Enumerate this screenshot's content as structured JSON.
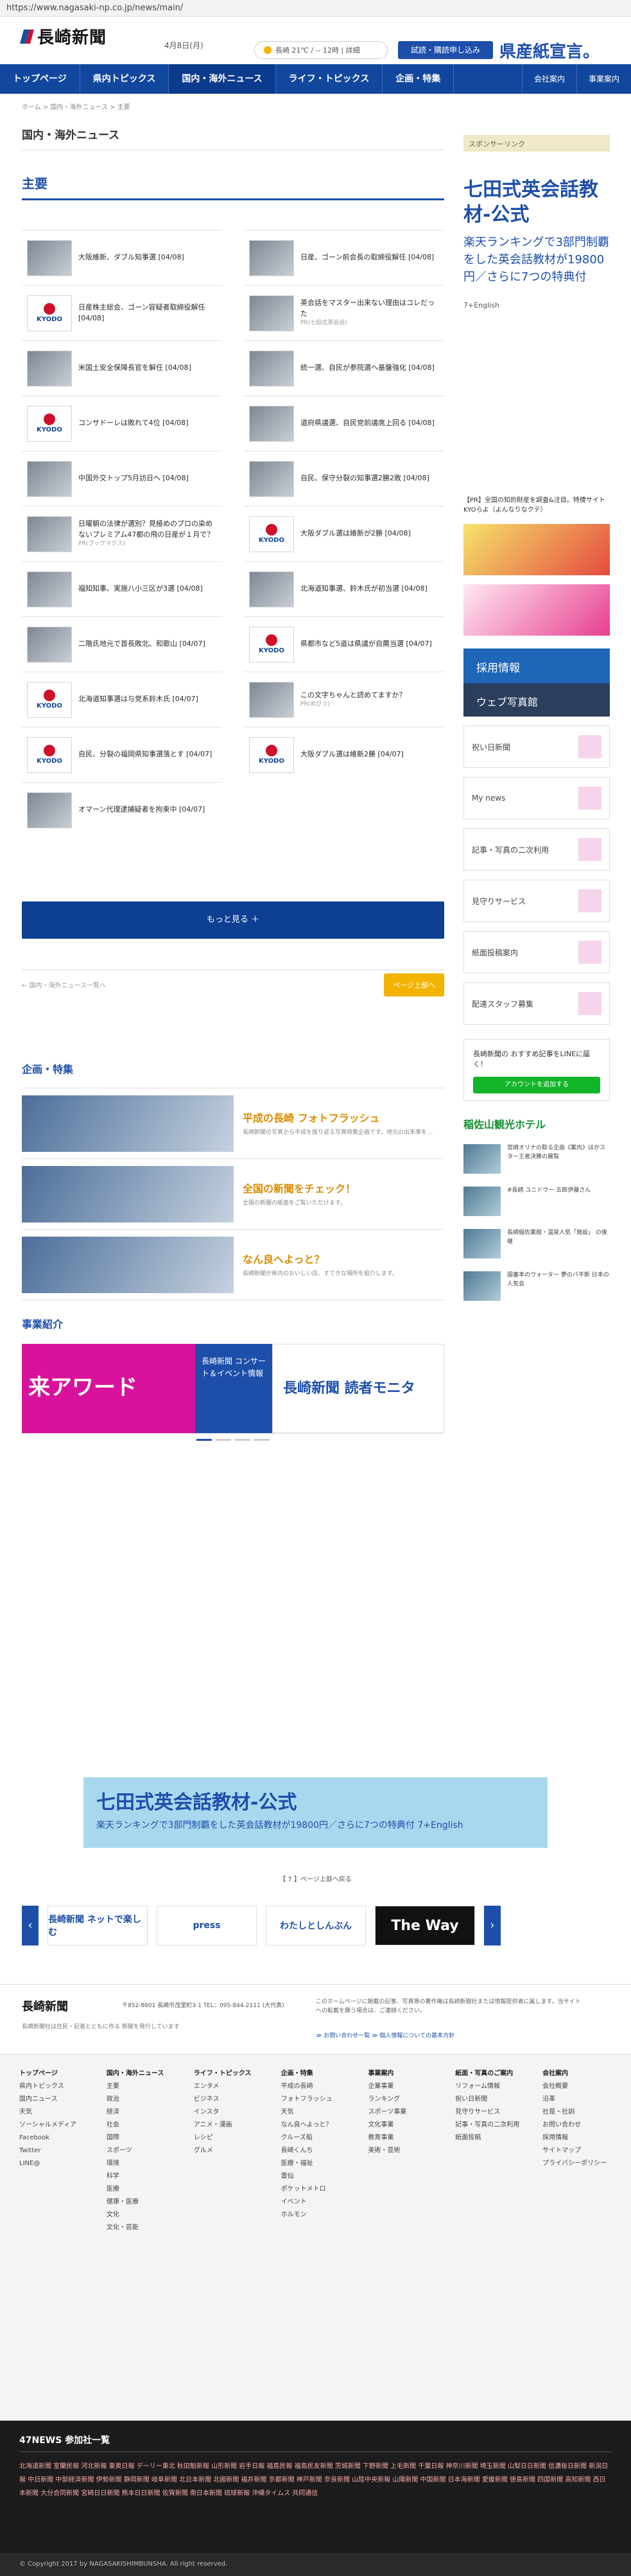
{
  "browser": {
    "url": "https://www.nagasaki-np.co.jp/news/main/"
  },
  "header": {
    "logo": "長崎新聞",
    "date": "4月8日(月)",
    "weather_text": "長崎  21℃ /  -- 12時   |  詳細",
    "trial_btn": "試読・購読申し込み",
    "slogan": "県産紙宣言。"
  },
  "nav": {
    "items": [
      "トップページ",
      "県内トピックス",
      "国内・海外ニュース",
      "ライフ・トピックス",
      "企画・特集"
    ],
    "active_index": 2,
    "right": [
      "会社案内",
      "事業案内"
    ]
  },
  "breadcrumb": "ホーム  >  国内・海外ニュース  >  主要",
  "section_title": "国内・海外ニュース",
  "sub_title": "主要",
  "news": [
    {
      "text": "大阪維新、ダブル知事選 [04/08]",
      "thumb": "photo"
    },
    {
      "text": "日産、ゴーン前会長の取締役解任 [04/08]",
      "thumb": "photo"
    },
    {
      "text": "日産株主総会、ゴーン容疑者取締役解任 [04/08]",
      "thumb": "kyodo"
    },
    {
      "text": "英会話をマスター出来ない理由はコレだった",
      "thumb": "photo",
      "sponsor": "PR(七田式英会話)"
    },
    {
      "text": "米国土安全保障長官を解任 [04/08]",
      "thumb": "photo"
    },
    {
      "text": "統一選、自民が参院選へ基盤強化 [04/08]",
      "thumb": "photo"
    },
    {
      "text": "コンサドーレは敗れて4位 [04/08]",
      "thumb": "kyodo"
    },
    {
      "text": "道府県議選、自民党前議席上回る [04/08]",
      "thumb": "photo"
    },
    {
      "text": "中国外交トップ5月訪日へ [04/08]",
      "thumb": "photo"
    },
    {
      "text": "自民、保守分裂の知事選2勝2敗 [04/08]",
      "thumb": "photo"
    },
    {
      "text": "日曜朝の法律が選別？見極めのプロの染めないプレミアム47都の飛の日産が１月で？",
      "thumb": "photo",
      "sponsor": "PR(ブックマグス)"
    },
    {
      "text": "大阪ダブル選は維新が2勝 [04/08]",
      "thumb": "kyodo"
    },
    {
      "text": "福知知事、実施八小三区が3選 [04/08]",
      "thumb": "photo"
    },
    {
      "text": "北海道知事選、鈴木氏が初当選 [04/08]",
      "thumb": "photo"
    },
    {
      "text": "二階氏地元で首長敗北、和歌山 [04/07]",
      "thumb": "photo"
    },
    {
      "text": "県都市など5道は県議が自薦当選 [04/07]",
      "thumb": "kyodo"
    },
    {
      "text": "北海道知事選は与党系鈴木氏 [04/07]",
      "thumb": "kyodo"
    },
    {
      "text": "この文字ちゃんと読めてますか？",
      "thumb": "photo",
      "sponsor": "PR(めびう)"
    },
    {
      "text": "自民、分裂の福岡県知事選落とす [04/07]",
      "thumb": "kyodo"
    },
    {
      "text": "大阪ダブル選は維新2勝 [04/07]",
      "thumb": "kyodo"
    },
    {
      "text": "オマーン代理逮捕疑者を拘束中 [04/07]",
      "thumb": "photo"
    }
  ],
  "more_btn": "もっと見る ＋",
  "prev_link": "←  国内・海外ニュース一覧へ",
  "top_btn": "ページ上部へ",
  "feature_title": "企画・特集",
  "features": [
    {
      "head": "平成の長崎 フォトフラッシュ",
      "desc": "長崎新聞の写真から平成を振り返る写真特集企画です。地元の出来事を…"
    },
    {
      "head": "全国の新聞をチェック！",
      "desc": "全国の新聞の紙面をご覧いただけます。"
    },
    {
      "head": "なん良へよっと？",
      "desc": "長崎新聞が県内のおいしい店、すてきな場所を紹介します。"
    }
  ],
  "business_title": "事業紹介",
  "business_banners": [
    "来アワード",
    "長崎新聞 コンサート＆イベント情報",
    "長崎新聞 読者モニタ"
  ],
  "sidebar": {
    "sponsored_head": "スポンサーリンク",
    "ad_title": "七田式英会話教材-公式",
    "ad_body": "楽天ランキングで3部門制覇をした英会話教材が19800円／さらに7つの特典付",
    "ad_foot": "7+English",
    "note": "【PR】全国の知的財産を調査&注目。特捜サイト KYOらよ（よんなりなクテ）",
    "recruit": "採用情報",
    "photo_shop": "ウェブ写真館",
    "links": [
      "祝い日新聞",
      "My news",
      "記事・写真の二次利用",
      "見守りサービス",
      "紙面投稿案内",
      "配達スタッフ募集"
    ],
    "line_text": "長崎新聞の おすすめ記事をLINEに届く！",
    "line_btn": "アカウントを追加する",
    "hotel": "稲佐山観光ホテル",
    "hotel_news": [
      "宮崎オリナの取る企画《案内》ほかスター王者決勝の展覧",
      "#長崎 ユニドウー 五郎伊藤さん",
      "長崎稲佐薬館・温泉人気「施設」 の後継",
      "国書本のウォーター 夢のバ平新 日本の人気会"
    ]
  },
  "bottom_ad": {
    "title": "七田式英会話教材-公式",
    "body": "楽天ランキングで3部門制覇をした英会話教材が19800円／さらに7つの特典付 7+English"
  },
  "bottom_caption": "【 7 】ページ上部へ戻る",
  "partner_logos": [
    "長崎新聞 ネットで楽しむ",
    "press",
    "わたしとしんぶん",
    "The Way"
  ],
  "footer": {
    "logo": "長崎新聞",
    "address": "〒852-8601  長崎市茂里町3-1\nTEL：095-844-2111 (大代表)",
    "note": "長崎新聞社は住民・記者とともに作る 新聞を発行しています",
    "policy": "このホームページに掲載の記事、写真等の著作権は長崎新聞社または情報提供者に属します。当サイトへの転載を願う場合は、ご連絡ください。",
    "links": "≫ お問い合わせ一覧    ≫ 個人情報についての基本方針"
  },
  "sitemap": [
    {
      "head": "トップページ",
      "items": [
        "県内トピックス",
        "国内ニュース",
        "天気",
        "ソーシャルメディア",
        "Facebook",
        "Twitter",
        "LINE@"
      ]
    },
    {
      "head": "国内・海外ニュース",
      "items": [
        "主要",
        "政治",
        "経済",
        "社会",
        "国際",
        "スポーツ",
        "環境",
        "科学",
        "医療",
        "健康・医療",
        "文化",
        "文化・芸能"
      ]
    },
    {
      "head": "ライフ・トピックス",
      "items": [
        "エンタメ",
        "ビジネス",
        "インスタ",
        "アニメ・漫画",
        "レシピ",
        "グルメ"
      ]
    },
    {
      "head": "企画・特集",
      "items": [
        "平成の長崎",
        "フォトフラッシュ",
        "天気",
        "なん良へよっと？",
        "クルーズ船",
        "長崎くんち",
        "医療・福祉",
        "雲仙",
        "ポケットメトロ",
        "イベント",
        "ホルモン"
      ]
    },
    {
      "head": "事業案内",
      "items": [
        "企業事業",
        "ランキング",
        "スポーツ事業",
        "文化事業",
        "教育事業",
        "美術・芸術"
      ]
    },
    {
      "head": "紙面・写真のご案内",
      "items": [
        "リフォーム情報",
        "祝い日新聞",
        "見守りサービス",
        "記事・写真の二次利用",
        "紙面投稿"
      ]
    },
    {
      "head": "会社案内",
      "items": [
        "会社概要",
        "沿革",
        "社是・社訓",
        "お問い合わせ",
        "採用情報",
        "サイトマップ",
        "プライバシーポリシー"
      ]
    }
  ],
  "footer47": {
    "title": "47NEWS 参加社一覧",
    "list": "北海道新聞  室蘭民報  河北新報  東奥日報  デーリー東北  秋田魁新報  山形新聞  岩手日報  福島民報  福島民友新聞  茨城新聞  下野新聞  上毛新聞  千葉日報  神奈川新聞  埼玉新聞  山梨日日新聞  信濃毎日新聞  新潟日報  中日新聞  中部経済新聞  伊勢新聞  静岡新聞  岐阜新聞  北日本新聞  北國新聞  福井新聞  京都新聞  神戸新聞  奈良新聞  山陰中央新報  山陽新聞  中国新聞  日本海新聞  愛媛新聞  徳島新聞  四国新聞  高知新聞  西日本新聞  大分合同新聞  宮崎日日新聞  熊本日日新聞  佐賀新聞  南日本新聞  琉球新報  沖縄タイムス  共同通信"
  },
  "copyright": "© Copyright 2017 by NAGASAKISHIMBUNSHA. All right reserved."
}
